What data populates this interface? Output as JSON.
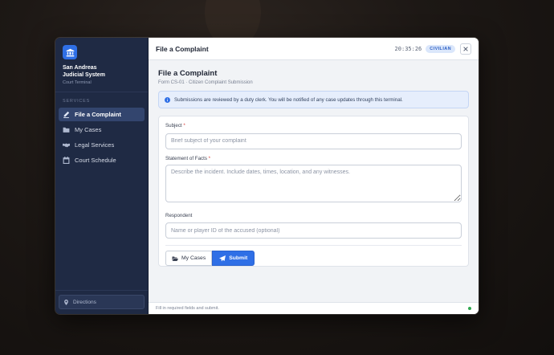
{
  "brand": {
    "title_line1": "San Andreas",
    "title_line2": "Judicial System",
    "subtitle": "Court Terminal"
  },
  "sidebar": {
    "section_label": "SERVICES",
    "items": [
      {
        "label": "File a Complaint",
        "icon": "edit-icon",
        "active": true
      },
      {
        "label": "My Cases",
        "icon": "folder-icon",
        "active": false
      },
      {
        "label": "Legal Services",
        "icon": "handshake-icon",
        "active": false
      },
      {
        "label": "Court Schedule",
        "icon": "calendar-icon",
        "active": false
      }
    ],
    "footer_button": "Directions"
  },
  "topbar": {
    "title": "File a Complaint",
    "clock": "20:35:26",
    "role": "CIVILIAN"
  },
  "page": {
    "title": "File a Complaint",
    "subtitle": "Form CS-01 · Citizen Complaint Submission",
    "info": "Submissions are reviewed by a duty clerk. You will be notified of any case updates through this terminal."
  },
  "form": {
    "subject": {
      "label": "Subject",
      "required_mark": "*",
      "placeholder": "Brief subject of your complaint",
      "value": ""
    },
    "statement": {
      "label": "Statement of Facts",
      "required_mark": "*",
      "placeholder": "Describe the incident. Include dates, times, location, and any witnesses.",
      "value": ""
    },
    "respondent": {
      "label": "Respondent",
      "placeholder": "Name or player ID of the accused (optional)",
      "value": ""
    },
    "secondary_button": "My Cases",
    "submit_button": "Submit"
  },
  "statusbar": {
    "text": "Fill in required fields and submit.",
    "status_color": "#2fa84f"
  },
  "colors": {
    "accent": "#2f6fe6",
    "sidebar": "#1f2a44"
  }
}
